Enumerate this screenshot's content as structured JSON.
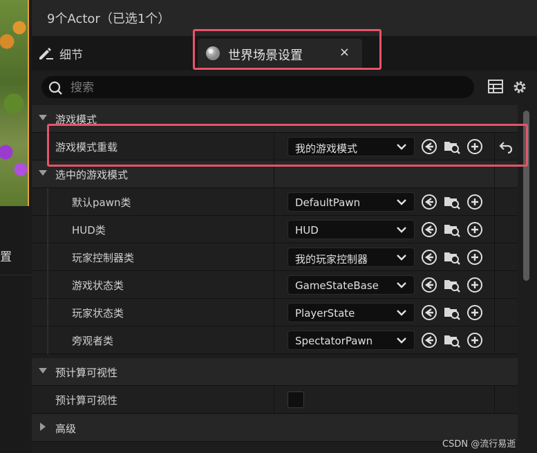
{
  "left": {
    "label": "置"
  },
  "actor_bar": {
    "text": "9个Actor（已选1个）"
  },
  "tabs": {
    "details": {
      "label": "细节"
    },
    "world": {
      "label": "世界场景设置",
      "close": "×"
    }
  },
  "search": {
    "placeholder": "搜索",
    "value": ""
  },
  "grid": {
    "cat_game_mode": "游戏模式",
    "game_mode_override": {
      "label": "游戏模式重载",
      "value": "我的游戏模式"
    },
    "cat_selected": "选中的游戏模式",
    "pawn": {
      "label": "默认pawn类",
      "value": "DefaultPawn"
    },
    "hud": {
      "label": "HUD类",
      "value": "HUD"
    },
    "pc": {
      "label": "玩家控制器类",
      "value": "我的玩家控制器"
    },
    "gs": {
      "label": "游戏状态类",
      "value": "GameStateBase"
    },
    "ps": {
      "label": "玩家状态类",
      "value": "PlayerState"
    },
    "spec": {
      "label": "旁观者类",
      "value": "SpectatorPawn"
    },
    "cat_precompute": "预计算可视性",
    "precompute": {
      "label": "预计算可视性",
      "checked": false
    },
    "cat_advanced": "高级"
  },
  "colors": {
    "highlight": "#e8546a",
    "panel": "#1d1d1d"
  },
  "watermark": "CSDN @流行易逝"
}
